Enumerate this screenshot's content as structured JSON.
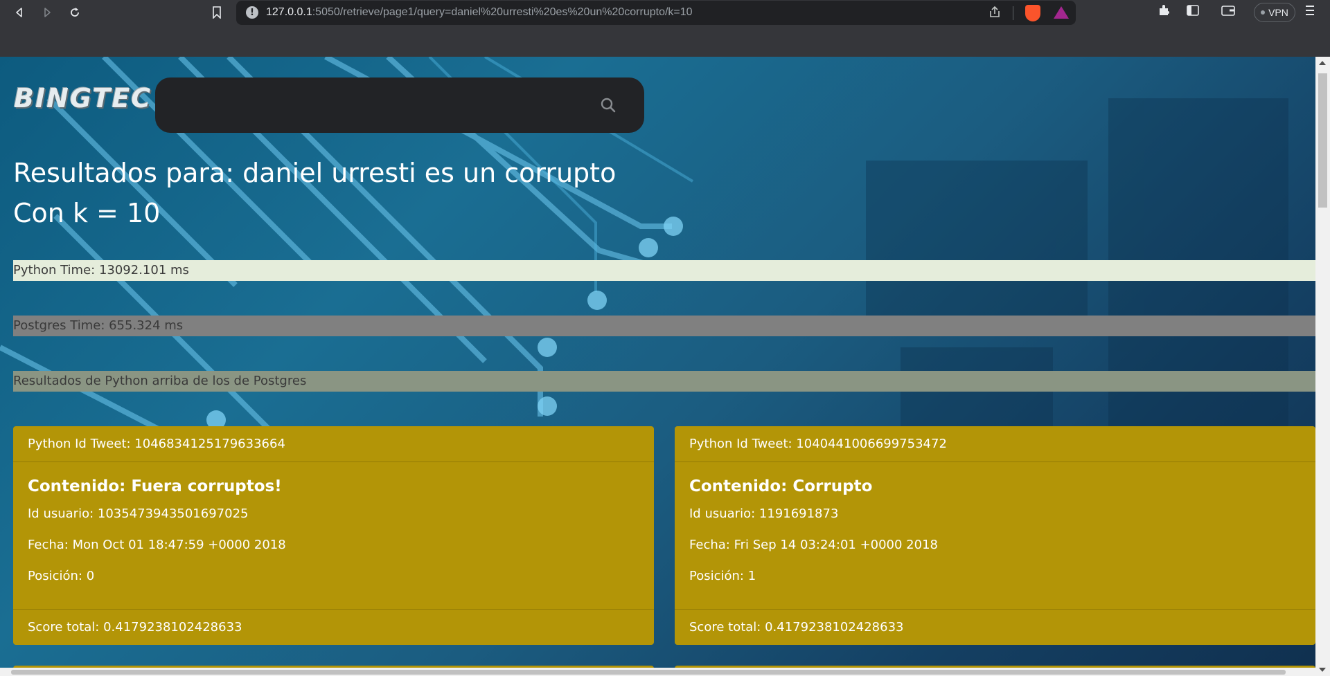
{
  "browser": {
    "url_host": "127.0.0.1",
    "url_rest": ":5050/retrieve/page1/query=daniel%20urresti%20es%20un%20corrupto/k=10",
    "vpn_label": "VPN"
  },
  "logo": {
    "text": "BINGTEC"
  },
  "search": {
    "value": "",
    "placeholder": ""
  },
  "header": {
    "results_for": "Resultados para: daniel urresti es un corrupto",
    "k_label": "Con k = 10"
  },
  "stats": {
    "python_time": "Python Time: 13092.101 ms",
    "postgres_time": "Postgres Time: 655.324 ms",
    "note": "Resultados de Python arriba de los de Postgres"
  },
  "results": [
    {
      "tweet_id": "Python Id Tweet: 1046834125179633664",
      "content": "Contenido: Fuera corruptos!",
      "user_id": "Id usuario: 1035473943501697025",
      "date": "Fecha: Mon Oct 01 18:47:59 +0000 2018",
      "position": "Posición: 0",
      "score": "Score total: 0.4179238102428633"
    },
    {
      "tweet_id": "Python Id Tweet: 1040441006699753472",
      "content": "Contenido: Corrupto",
      "user_id": "Id usuario: 1191691873",
      "date": "Fecha: Fri Sep 14 03:24:01 +0000 2018",
      "position": "Posición: 1",
      "score": "Score total: 0.4179238102428633"
    }
  ],
  "colors": {
    "card": "#b39507",
    "python_strip": "#e5eddb",
    "postgres_strip": "#808080",
    "note_strip": "#8a9583"
  }
}
